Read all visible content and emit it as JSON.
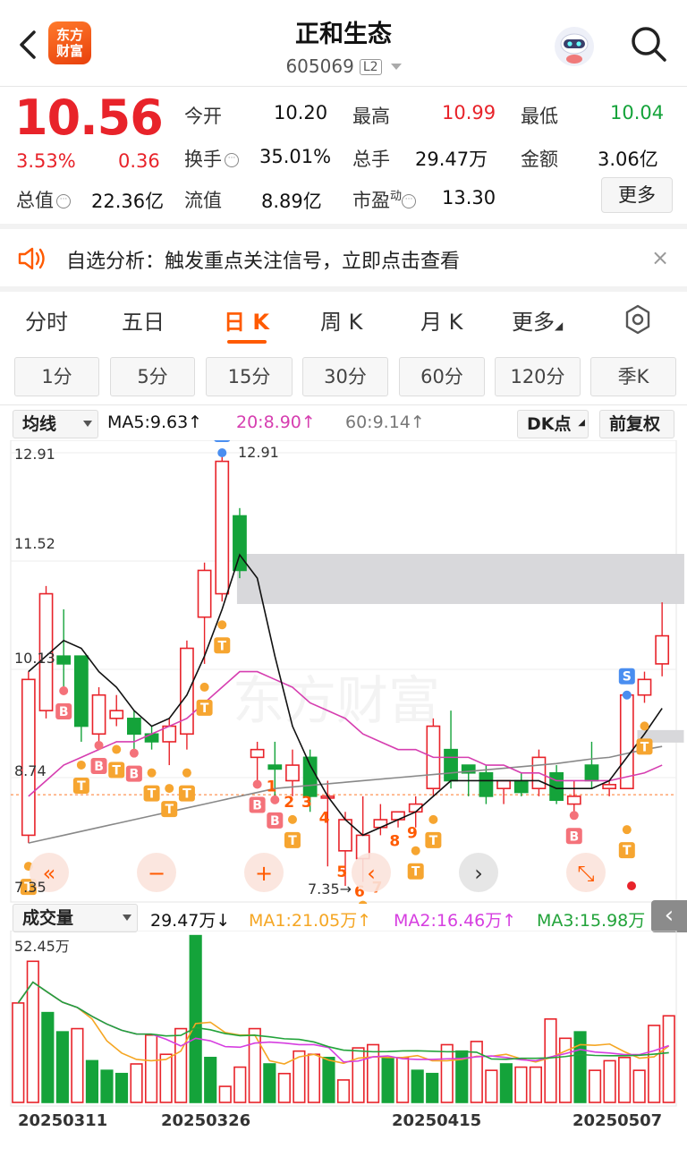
{
  "header": {
    "name": "正和生态",
    "code": "605069",
    "level": "L2",
    "logo": "东方\n财富",
    "icons": [
      "back-icon",
      "robot-icon",
      "search-icon"
    ]
  },
  "quote": {
    "price": "10.56",
    "change_pct": "3.53%",
    "change": "0.36",
    "fields": {
      "open_label": "今开",
      "open": "10.20",
      "high_label": "最高",
      "high": "10.99",
      "low_label": "最低",
      "low": "10.04",
      "turnover_label": "换手",
      "turnover": "35.01%",
      "volume_label": "总手",
      "volume": "29.47万",
      "amount_label": "金额",
      "amount": "3.06亿",
      "mktcap_label": "总值",
      "mktcap": "22.36亿",
      "float_label": "流值",
      "float_cap": "8.89亿",
      "pe_label": "市盈",
      "pe_sup": "动",
      "pe": "13.30"
    },
    "more_button": "更多"
  },
  "notice": {
    "text": "自选分析：触发重点关注信号，立即点击查看",
    "close": "×"
  },
  "tabs": {
    "items": [
      "分时",
      "五日",
      "日 K",
      "周 K",
      "月 K",
      "更多"
    ],
    "active": "日 K"
  },
  "periods": [
    "1分",
    "5分",
    "15分",
    "30分",
    "60分",
    "120分",
    "季K"
  ],
  "ma_bar": {
    "selector": "均线",
    "ma5": "MA5:9.63↑",
    "ma20": "20:8.90↑",
    "ma60": "60:9.14↑",
    "dk": "DK点",
    "adjust": "前复权"
  },
  "colors": {
    "up": "#e8232a",
    "down": "#14a33a",
    "accent": "#ff5a00",
    "ma5": "#111111",
    "ma20": "#d63eb0",
    "ma60": "#888888",
    "vma1": "#f5a623",
    "vma2": "#d63ee0",
    "vma3": "#22a33a"
  },
  "chart_data": {
    "type": "candlestick",
    "price_axis": {
      "labels": [
        "12.91",
        "11.52",
        "10.13",
        "8.74",
        "7.35"
      ],
      "ylim": [
        7.35,
        12.91
      ]
    },
    "annotations": {
      "high": "12.91",
      "low": "7.35→"
    },
    "dates": [
      "20250311",
      "20250326",
      "20250415",
      "20250507"
    ],
    "candles": [
      {
        "o": 8.0,
        "h": 10.1,
        "l": 7.9,
        "c": 10.0
      },
      {
        "o": 9.6,
        "h": 11.2,
        "l": 9.5,
        "c": 11.1
      },
      {
        "o": 10.3,
        "h": 10.9,
        "l": 9.9,
        "c": 10.2
      },
      {
        "o": 10.3,
        "h": 10.3,
        "l": 9.2,
        "c": 9.4
      },
      {
        "o": 9.3,
        "h": 9.9,
        "l": 9.2,
        "c": 9.8
      },
      {
        "o": 9.5,
        "h": 9.8,
        "l": 9.4,
        "c": 9.6
      },
      {
        "o": 9.5,
        "h": 9.6,
        "l": 9.1,
        "c": 9.3
      },
      {
        "o": 9.3,
        "h": 9.4,
        "l": 9.1,
        "c": 9.2
      },
      {
        "o": 9.2,
        "h": 9.5,
        "l": 8.9,
        "c": 9.4
      },
      {
        "o": 9.3,
        "h": 10.5,
        "l": 9.1,
        "c": 10.4
      },
      {
        "o": 10.8,
        "h": 11.5,
        "l": 10.2,
        "c": 11.4
      },
      {
        "o": 11.1,
        "h": 12.91,
        "l": 11.0,
        "c": 12.8
      },
      {
        "o": 12.1,
        "h": 12.2,
        "l": 11.3,
        "c": 11.4
      },
      {
        "o": 9.0,
        "h": 9.2,
        "l": 8.7,
        "c": 9.1
      },
      {
        "o": 8.9,
        "h": 9.2,
        "l": 8.5,
        "c": 8.85
      },
      {
        "o": 8.7,
        "h": 9.1,
        "l": 8.5,
        "c": 8.9
      },
      {
        "o": 9.0,
        "h": 9.1,
        "l": 8.3,
        "c": 8.5
      },
      {
        "o": 8.5,
        "h": 8.7,
        "l": 7.6,
        "c": 8.5
      },
      {
        "o": 7.8,
        "h": 8.3,
        "l": 7.35,
        "c": 8.2
      },
      {
        "o": 7.7,
        "h": 8.5,
        "l": 7.4,
        "c": 8.0
      },
      {
        "o": 8.1,
        "h": 8.4,
        "l": 8.0,
        "c": 8.2
      },
      {
        "o": 8.2,
        "h": 8.3,
        "l": 8.1,
        "c": 8.3
      },
      {
        "o": 8.3,
        "h": 8.5,
        "l": 8.1,
        "c": 8.4
      },
      {
        "o": 8.6,
        "h": 9.5,
        "l": 8.5,
        "c": 9.4
      },
      {
        "o": 9.1,
        "h": 9.6,
        "l": 8.6,
        "c": 8.7
      },
      {
        "o": 8.9,
        "h": 8.9,
        "l": 8.5,
        "c": 8.8
      },
      {
        "o": 8.8,
        "h": 8.9,
        "l": 8.4,
        "c": 8.5
      },
      {
        "o": 8.6,
        "h": 8.7,
        "l": 8.4,
        "c": 8.7
      },
      {
        "o": 8.7,
        "h": 8.8,
        "l": 8.5,
        "c": 8.55
      },
      {
        "o": 8.6,
        "h": 9.1,
        "l": 8.5,
        "c": 9.0
      },
      {
        "o": 8.8,
        "h": 8.9,
        "l": 8.4,
        "c": 8.45
      },
      {
        "o": 8.4,
        "h": 8.7,
        "l": 8.3,
        "c": 8.5
      },
      {
        "o": 8.9,
        "h": 9.2,
        "l": 8.6,
        "c": 8.7
      },
      {
        "o": 8.6,
        "h": 8.7,
        "l": 8.5,
        "c": 8.65
      },
      {
        "o": 8.6,
        "h": 9.8,
        "l": 8.6,
        "c": 9.8
      },
      {
        "o": 9.8,
        "h": 10.1,
        "l": 9.7,
        "c": 10.0
      },
      {
        "o": 10.2,
        "h": 10.99,
        "l": 10.04,
        "c": 10.56
      }
    ],
    "ma5": [
      10.1,
      10.3,
      10.5,
      10.4,
      10.1,
      9.9,
      9.6,
      9.4,
      9.5,
      9.8,
      10.3,
      10.9,
      11.6,
      11.3,
      10.3,
      9.4,
      8.9,
      8.5,
      8.2,
      8.0,
      8.1,
      8.2,
      8.3,
      8.5,
      8.7,
      8.7,
      8.7,
      8.7,
      8.7,
      8.7,
      8.6,
      8.6,
      8.6,
      8.7,
      9.0,
      9.3,
      9.63
    ],
    "ma20": [
      8.5,
      8.7,
      8.9,
      9.0,
      9.1,
      9.2,
      9.2,
      9.3,
      9.4,
      9.5,
      9.7,
      9.9,
      10.1,
      10.1,
      10.0,
      9.9,
      9.7,
      9.6,
      9.5,
      9.3,
      9.2,
      9.1,
      9.1,
      9.0,
      9.0,
      9.0,
      8.9,
      8.9,
      8.8,
      8.8,
      8.7,
      8.7,
      8.7,
      8.7,
      8.75,
      8.8,
      8.9
    ],
    "ma60": [
      7.9,
      7.95,
      8.0,
      8.05,
      8.1,
      8.15,
      8.2,
      8.25,
      8.3,
      8.35,
      8.4,
      8.45,
      8.5,
      8.55,
      8.6,
      8.62,
      8.64,
      8.66,
      8.68,
      8.7,
      8.72,
      8.74,
      8.76,
      8.78,
      8.8,
      8.82,
      8.84,
      8.86,
      8.88,
      8.9,
      8.92,
      8.95,
      8.98,
      9.0,
      9.05,
      9.1,
      9.14
    ],
    "markers": [
      {
        "i": 0,
        "t": "T"
      },
      {
        "i": 2,
        "t": "B"
      },
      {
        "i": 3,
        "t": "T"
      },
      {
        "i": 4,
        "t": "B"
      },
      {
        "i": 5,
        "t": "T"
      },
      {
        "i": 6,
        "t": "B"
      },
      {
        "i": 7,
        "t": "T"
      },
      {
        "i": 8,
        "t": "T"
      },
      {
        "i": 9,
        "t": "T"
      },
      {
        "i": 10,
        "t": "T"
      },
      {
        "i": 11,
        "t": "T"
      },
      {
        "i": 11,
        "t": "S"
      },
      {
        "i": 13,
        "t": "B"
      },
      {
        "i": 14,
        "t": "B"
      },
      {
        "i": 15,
        "t": "T"
      },
      {
        "i": 18,
        "t": "T"
      },
      {
        "i": 19,
        "t": "T"
      },
      {
        "i": 22,
        "t": "T"
      },
      {
        "i": 23,
        "t": "T"
      },
      {
        "i": 31,
        "t": "B"
      },
      {
        "i": 34,
        "t": "S"
      },
      {
        "i": 34,
        "t": "T"
      },
      {
        "i": 35,
        "t": "T"
      }
    ],
    "numbers": [
      {
        "i": 13,
        "n": "1"
      },
      {
        "i": 14,
        "n": "2"
      },
      {
        "i": 15,
        "n": "3"
      },
      {
        "i": 16,
        "n": "4"
      },
      {
        "i": 17,
        "n": "5"
      },
      {
        "i": 18,
        "n": "6"
      },
      {
        "i": 19,
        "n": "7"
      },
      {
        "i": 20,
        "n": "8"
      },
      {
        "i": 21,
        "n": "9"
      }
    ],
    "volume": {
      "selector": "成交量",
      "current": "29.47万↓",
      "ma1": "MA1:21.05万↑",
      "ma2": "MA2:16.46万↑",
      "ma3": "MA3:15.98万",
      "max_label": "52.45万",
      "values": [
        31,
        44,
        28,
        22,
        23,
        13,
        10,
        9,
        12,
        21,
        15,
        23,
        52,
        14,
        5,
        11,
        23,
        12,
        9,
        16,
        15,
        14,
        7,
        17,
        18,
        14,
        14,
        10,
        9,
        18,
        16,
        19,
        10,
        12,
        11,
        11,
        26,
        20,
        22,
        10,
        13,
        14,
        10,
        24,
        27
      ]
    }
  }
}
